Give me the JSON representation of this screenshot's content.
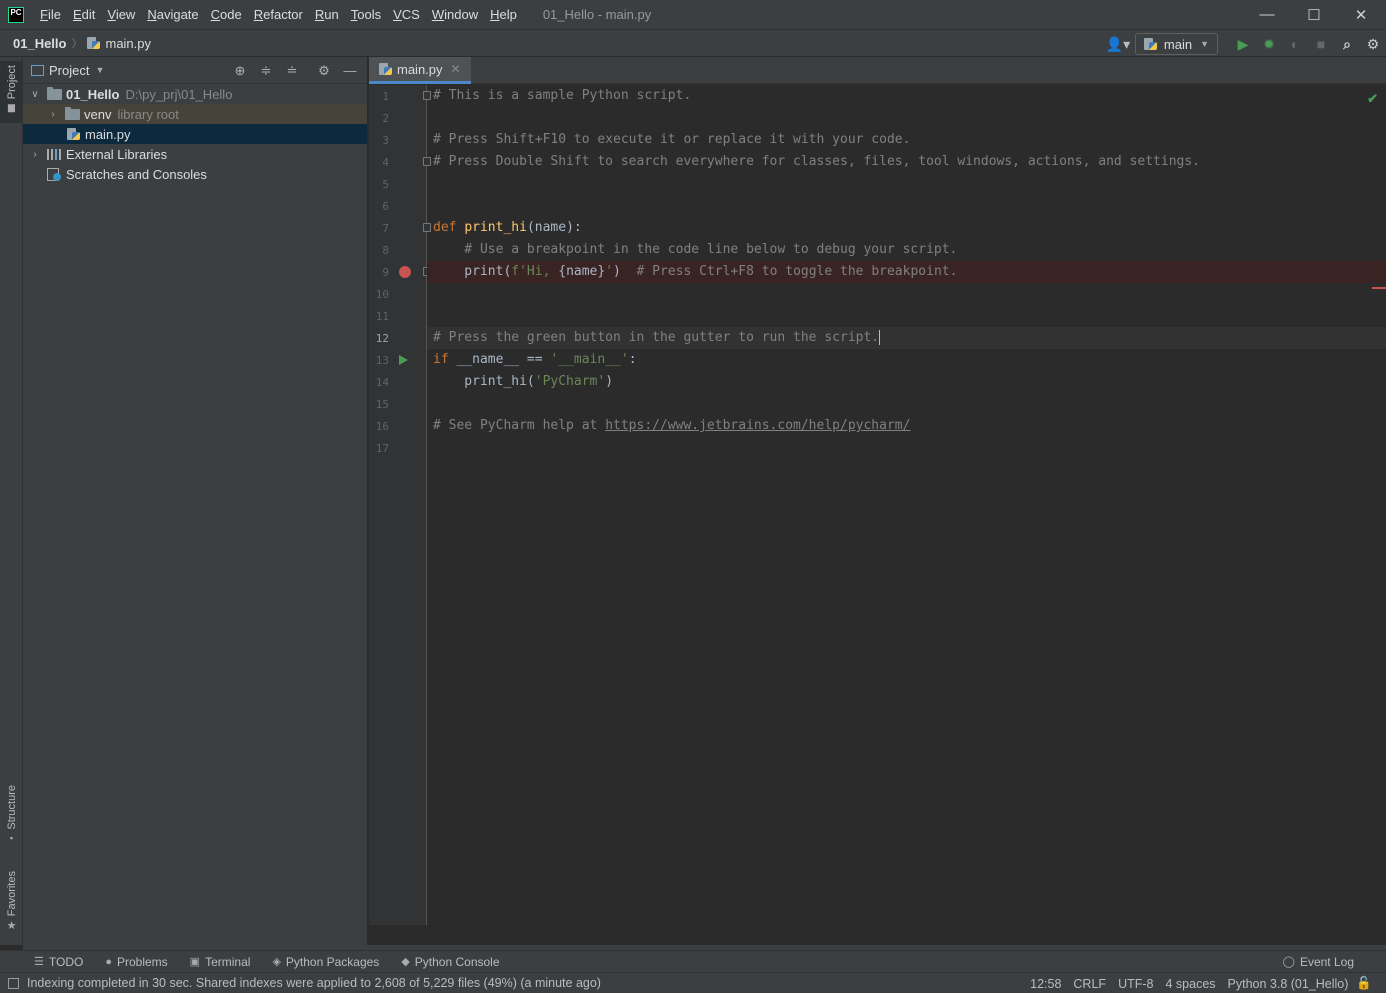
{
  "app": {
    "logo_text": "PC",
    "window_title": "01_Hello - main.py"
  },
  "menu": [
    "File",
    "Edit",
    "View",
    "Navigate",
    "Code",
    "Refactor",
    "Run",
    "Tools",
    "VCS",
    "Window",
    "Help"
  ],
  "window_controls": {
    "minimize": "—",
    "maximize": "☐",
    "close": "✕"
  },
  "breadcrumb": {
    "project": "01_Hello",
    "file": "main.py"
  },
  "toolbar": {
    "run_config": "main"
  },
  "left_stripe": {
    "project": "Project",
    "structure": "Structure",
    "favorites": "Favorites"
  },
  "project_panel": {
    "title": "Project",
    "tree": {
      "root_name": "01_Hello",
      "root_path": "D:\\py_prj\\01_Hello",
      "venv_name": "venv",
      "venv_hint": "library root",
      "main_file": "main.py",
      "external_libraries": "External Libraries",
      "scratches": "Scratches and Consoles"
    }
  },
  "editor": {
    "tab_label": "main.py",
    "line_numbers": [
      "1",
      "2",
      "3",
      "4",
      "5",
      "6",
      "7",
      "8",
      "9",
      "10",
      "11",
      "12",
      "13",
      "14",
      "15",
      "16",
      "17"
    ],
    "lines": {
      "l1": "# This is a sample Python script.",
      "l3": "# Press Shift+F10 to execute it or replace it with your code.",
      "l4": "# Press Double Shift to search everywhere for classes, files, tool windows, actions, and settings.",
      "l7_kw": "def",
      "l7_fn": "print_hi",
      "l7_rest": "(name):",
      "l8": "    # Use a breakpoint in the code line below to debug your script.",
      "l9_a": "    print(",
      "l9_str1": "f'Hi, ",
      "l9_interp": "{name}",
      "l9_str2": "'",
      "l9_b": ")  ",
      "l9_comment": "# Press Ctrl+F8 to toggle the breakpoint.",
      "l12": "# Press the green button in the gutter to run the script.",
      "l13_kw": "if",
      "l13_a": " __name__ == ",
      "l13_str": "'__main__'",
      "l13_b": ":",
      "l14_a": "    print_hi(",
      "l14_str": "'PyCharm'",
      "l14_b": ")",
      "l16_a": "# See PyCharm help at ",
      "l16_url": "https://www.jetbrains.com/help/pycharm/"
    }
  },
  "bottom_tabs": [
    "TODO",
    "Problems",
    "Terminal",
    "Python Packages",
    "Python Console"
  ],
  "event_log": "Event Log",
  "status": {
    "message": "Indexing completed in 30 sec. Shared indexes were applied to 2,608 of 5,229 files (49%) (a minute ago)",
    "position": "12:58",
    "line_sep": "CRLF",
    "encoding": "UTF-8",
    "indent": "4 spaces",
    "interpreter": "Python 3.8 (01_Hello)"
  },
  "colors": {
    "accent": "#4a88c7",
    "breakpoint": "#c75450",
    "run": "#499c54"
  }
}
